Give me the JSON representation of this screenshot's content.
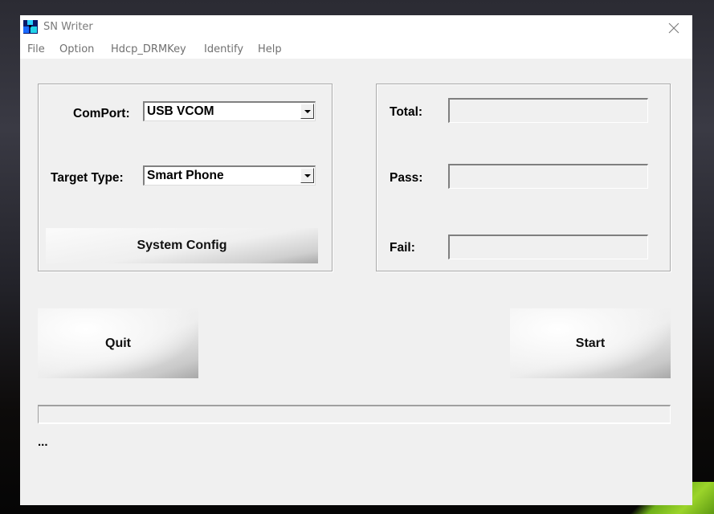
{
  "window": {
    "title": "SN Writer",
    "app_icon": "mtk-cubes-icon",
    "close_icon": "close-icon"
  },
  "menu": {
    "items": [
      "File",
      "Option",
      "Hdcp_DRMKey",
      "Identify",
      "Help"
    ]
  },
  "settings": {
    "comport_label": "ComPort:",
    "comport_value": "USB VCOM",
    "target_type_label": "Target Type:",
    "target_type_value": "Smart Phone",
    "system_config_label": "System Config"
  },
  "counters": {
    "total_label": "Total:",
    "total_value": "",
    "pass_label": "Pass:",
    "pass_value": "",
    "fail_label": "Fail:",
    "fail_value": ""
  },
  "actions": {
    "quit_label": "Quit",
    "start_label": "Start"
  },
  "progress": {
    "percent": 0
  },
  "status": {
    "text": "..."
  }
}
